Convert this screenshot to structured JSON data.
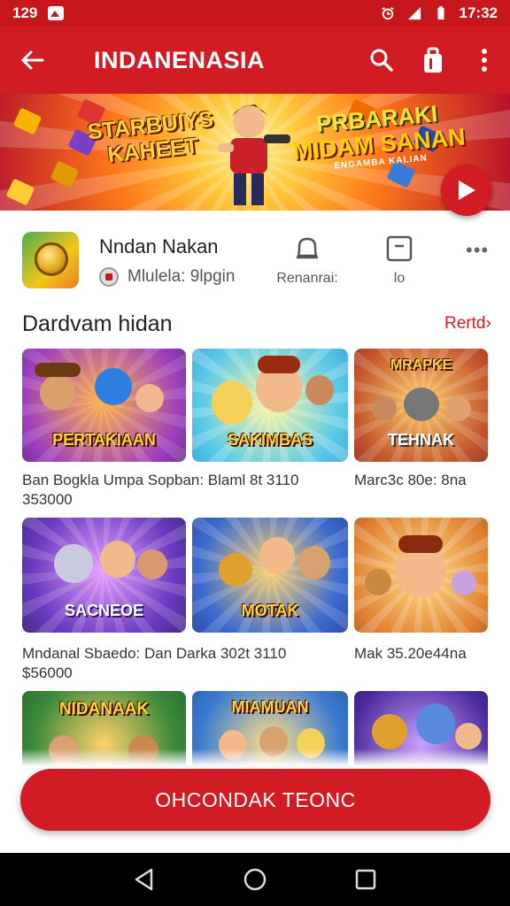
{
  "status_bar": {
    "time_left": "129",
    "time_right": "17:32"
  },
  "app_bar": {
    "title": "INDANENASIA"
  },
  "banner": {
    "left_title_line1": "STARBUIYS",
    "left_title_line2": "KAHEET",
    "right_title_line1": "PRBARAKI",
    "right_title_line2": "MIDAM SANAN",
    "right_subtitle": "ENGAMBA KALIAN"
  },
  "app_info": {
    "name": "Nndan Nakan",
    "developer": "Mlulela: 9lpgin",
    "meta1_label": "Renanrai:",
    "meta2_label": "lo"
  },
  "section": {
    "title": "Dardvam hidan",
    "link": "Rertd›"
  },
  "cards": [
    {
      "label": "PERTAKIAAN"
    },
    {
      "label": "SAKIMBAS"
    },
    {
      "label": "MRAPKE",
      "label2": "TEHNAK"
    },
    {
      "label": "SACNEOE"
    },
    {
      "label": "MOTAK"
    },
    {
      "label": ""
    },
    {
      "label": "NIDANAAK"
    },
    {
      "label": "MIAMUAN"
    },
    {
      "label": ""
    }
  ],
  "captions": {
    "row1_left_line1": "Ban Bogkla Umpa Sopban: Blaml 8t 3110",
    "row1_left_line2": "353000",
    "row1_right": "Marc3c 80e: 8na",
    "row2_left_line1": "Mndanal Sbaedo: Dan Darka 302t 3110",
    "row2_left_line2": "$56000",
    "row2_right": "Mak 35.20e44na"
  },
  "cta": {
    "label": "OHCONDAK TEONC"
  },
  "colors": {
    "primary": "#d01c22",
    "status": "#c8161d"
  },
  "icons": [
    "back-arrow-icon",
    "search-icon",
    "bag-icon",
    "more-vert-icon",
    "play-icon",
    "bell-icon",
    "square-icon",
    "back-triangle-icon",
    "home-circle-icon",
    "recents-square-icon"
  ]
}
